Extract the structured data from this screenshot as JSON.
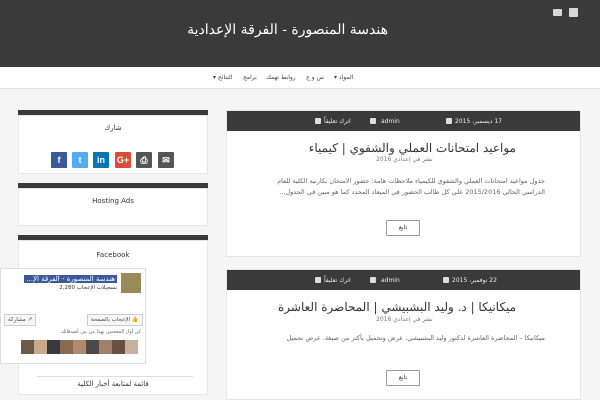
{
  "header": {
    "site_title": "هندسة المنصورة - الفرقة الإعدادية",
    "social_icons": [
      "facebook-icon",
      "mail-icon"
    ]
  },
  "nav": {
    "items": [
      "المواد ▾",
      "س و ج",
      "روابط تهمك",
      "برامج",
      "النتائج ▾"
    ]
  },
  "posts": [
    {
      "date": "17 ديسمبر، 2015",
      "author": "admin",
      "comments": "اترك تعليقاً",
      "title": "مواعيد امتحانات العملي والشفوي | كيمياء",
      "category_line": "نشر في إعدادي 2016",
      "excerpt": "جدول مواعيد امتحانات العملي والشفوي للكيمياء ملاحظات هامة: حضور الامتحان بكارنيه الكلية للعام الدراسي الحالي 2015/2016 على كل طالب الحضور في الميعاد المحدد كما هو مبين في الجدول...",
      "read_more": "تابع"
    },
    {
      "date": "22 نوفمبر، 2015",
      "author": "admin",
      "comments": "اترك تعليقاً",
      "title": "ميكانيكا | د. وليد البشبيشي | المحاضرة العاشرة",
      "category_line": "نشر في إعدادي 2016",
      "excerpt": "ميكانيكا – المحاضرة العاشرة لدكتور وليد البشبيشي. عرض وتحميل بأكثر من صيغة. عرض تحميل",
      "read_more": "تابع"
    }
  ],
  "sidebar": {
    "share_title": "شارك",
    "share_icons": [
      {
        "name": "facebook",
        "label": "f",
        "color": "#3b5998"
      },
      {
        "name": "twitter",
        "label": "t",
        "color": "#55acee"
      },
      {
        "name": "linkedin",
        "label": "in",
        "color": "#0077b5"
      },
      {
        "name": "google-plus",
        "label": "G+",
        "color": "#dd4b39"
      },
      {
        "name": "print",
        "label": "⎙",
        "color": "#555555"
      },
      {
        "name": "email",
        "label": "✉",
        "color": "#555555"
      }
    ],
    "hosting_title": "Hosting Ads",
    "facebook_title": "Facebook",
    "newsletter_title": "قائمة لمتابعة أخبار الكلية"
  },
  "fb_plugin": {
    "page_name": "هندسة المنصورة - الفرقة الإ...",
    "likes": "2,280 تسجيلات الإعجاب",
    "like_button": "الإعجاب بالصفحة 👍",
    "share_button": "مشاركة ↗",
    "friends_text": "كن أول المعجبين بهذا من بين أصدقائك",
    "face_colors": [
      "#6b5a4a",
      "#c9a98a",
      "#3a3a3a",
      "#8a6a50",
      "#b08a70",
      "#4a4a4a",
      "#a0806a",
      "#6a5040",
      "#c8b0a0"
    ]
  }
}
